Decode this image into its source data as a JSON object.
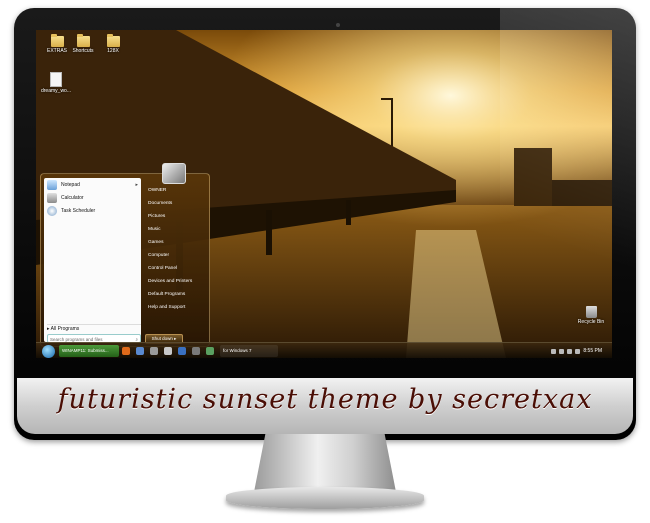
{
  "caption": "futuristic sunset theme by secretxax",
  "desktop_icons": [
    "EXTRAS",
    "Shortcuts",
    "128X",
    "dreamy_wo...",
    "Recycle Bin"
  ],
  "start_menu": {
    "programs": [
      "Notepad",
      "Calculator",
      "Task Scheduler"
    ],
    "all_programs": "All Programs",
    "search_placeholder": "Search programs and files",
    "right_items": [
      "OWNER",
      "Documents",
      "Pictures",
      "Music",
      "Games",
      "Computer",
      "Control Panel",
      "Devices and Printers",
      "Default Programs",
      "Help and Support"
    ],
    "shutdown": "Shut down"
  },
  "taskbar": {
    "apps": [
      "WINAMP11: Submiss...",
      "for Windows 7"
    ],
    "clock": "8:55 PM"
  },
  "colors": {
    "accent": "#f2b13a",
    "caption": "#4a0e05",
    "sky": "#c88a22"
  }
}
